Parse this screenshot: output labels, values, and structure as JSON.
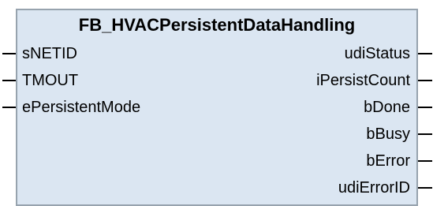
{
  "block": {
    "title": "FB_HVACPersistentDataHandling"
  },
  "inputs": [
    {
      "name": "sNETID"
    },
    {
      "name": "TMOUT"
    },
    {
      "name": "ePersistentMode"
    }
  ],
  "outputs": [
    {
      "name": "udiStatus"
    },
    {
      "name": "iPersistCount"
    },
    {
      "name": "bDone"
    },
    {
      "name": "bBusy"
    },
    {
      "name": "bError"
    },
    {
      "name": "udiErrorID"
    }
  ],
  "colors": {
    "block_fill": "#dbe6f2",
    "block_border": "#97a3ae",
    "wire": "#000000"
  }
}
